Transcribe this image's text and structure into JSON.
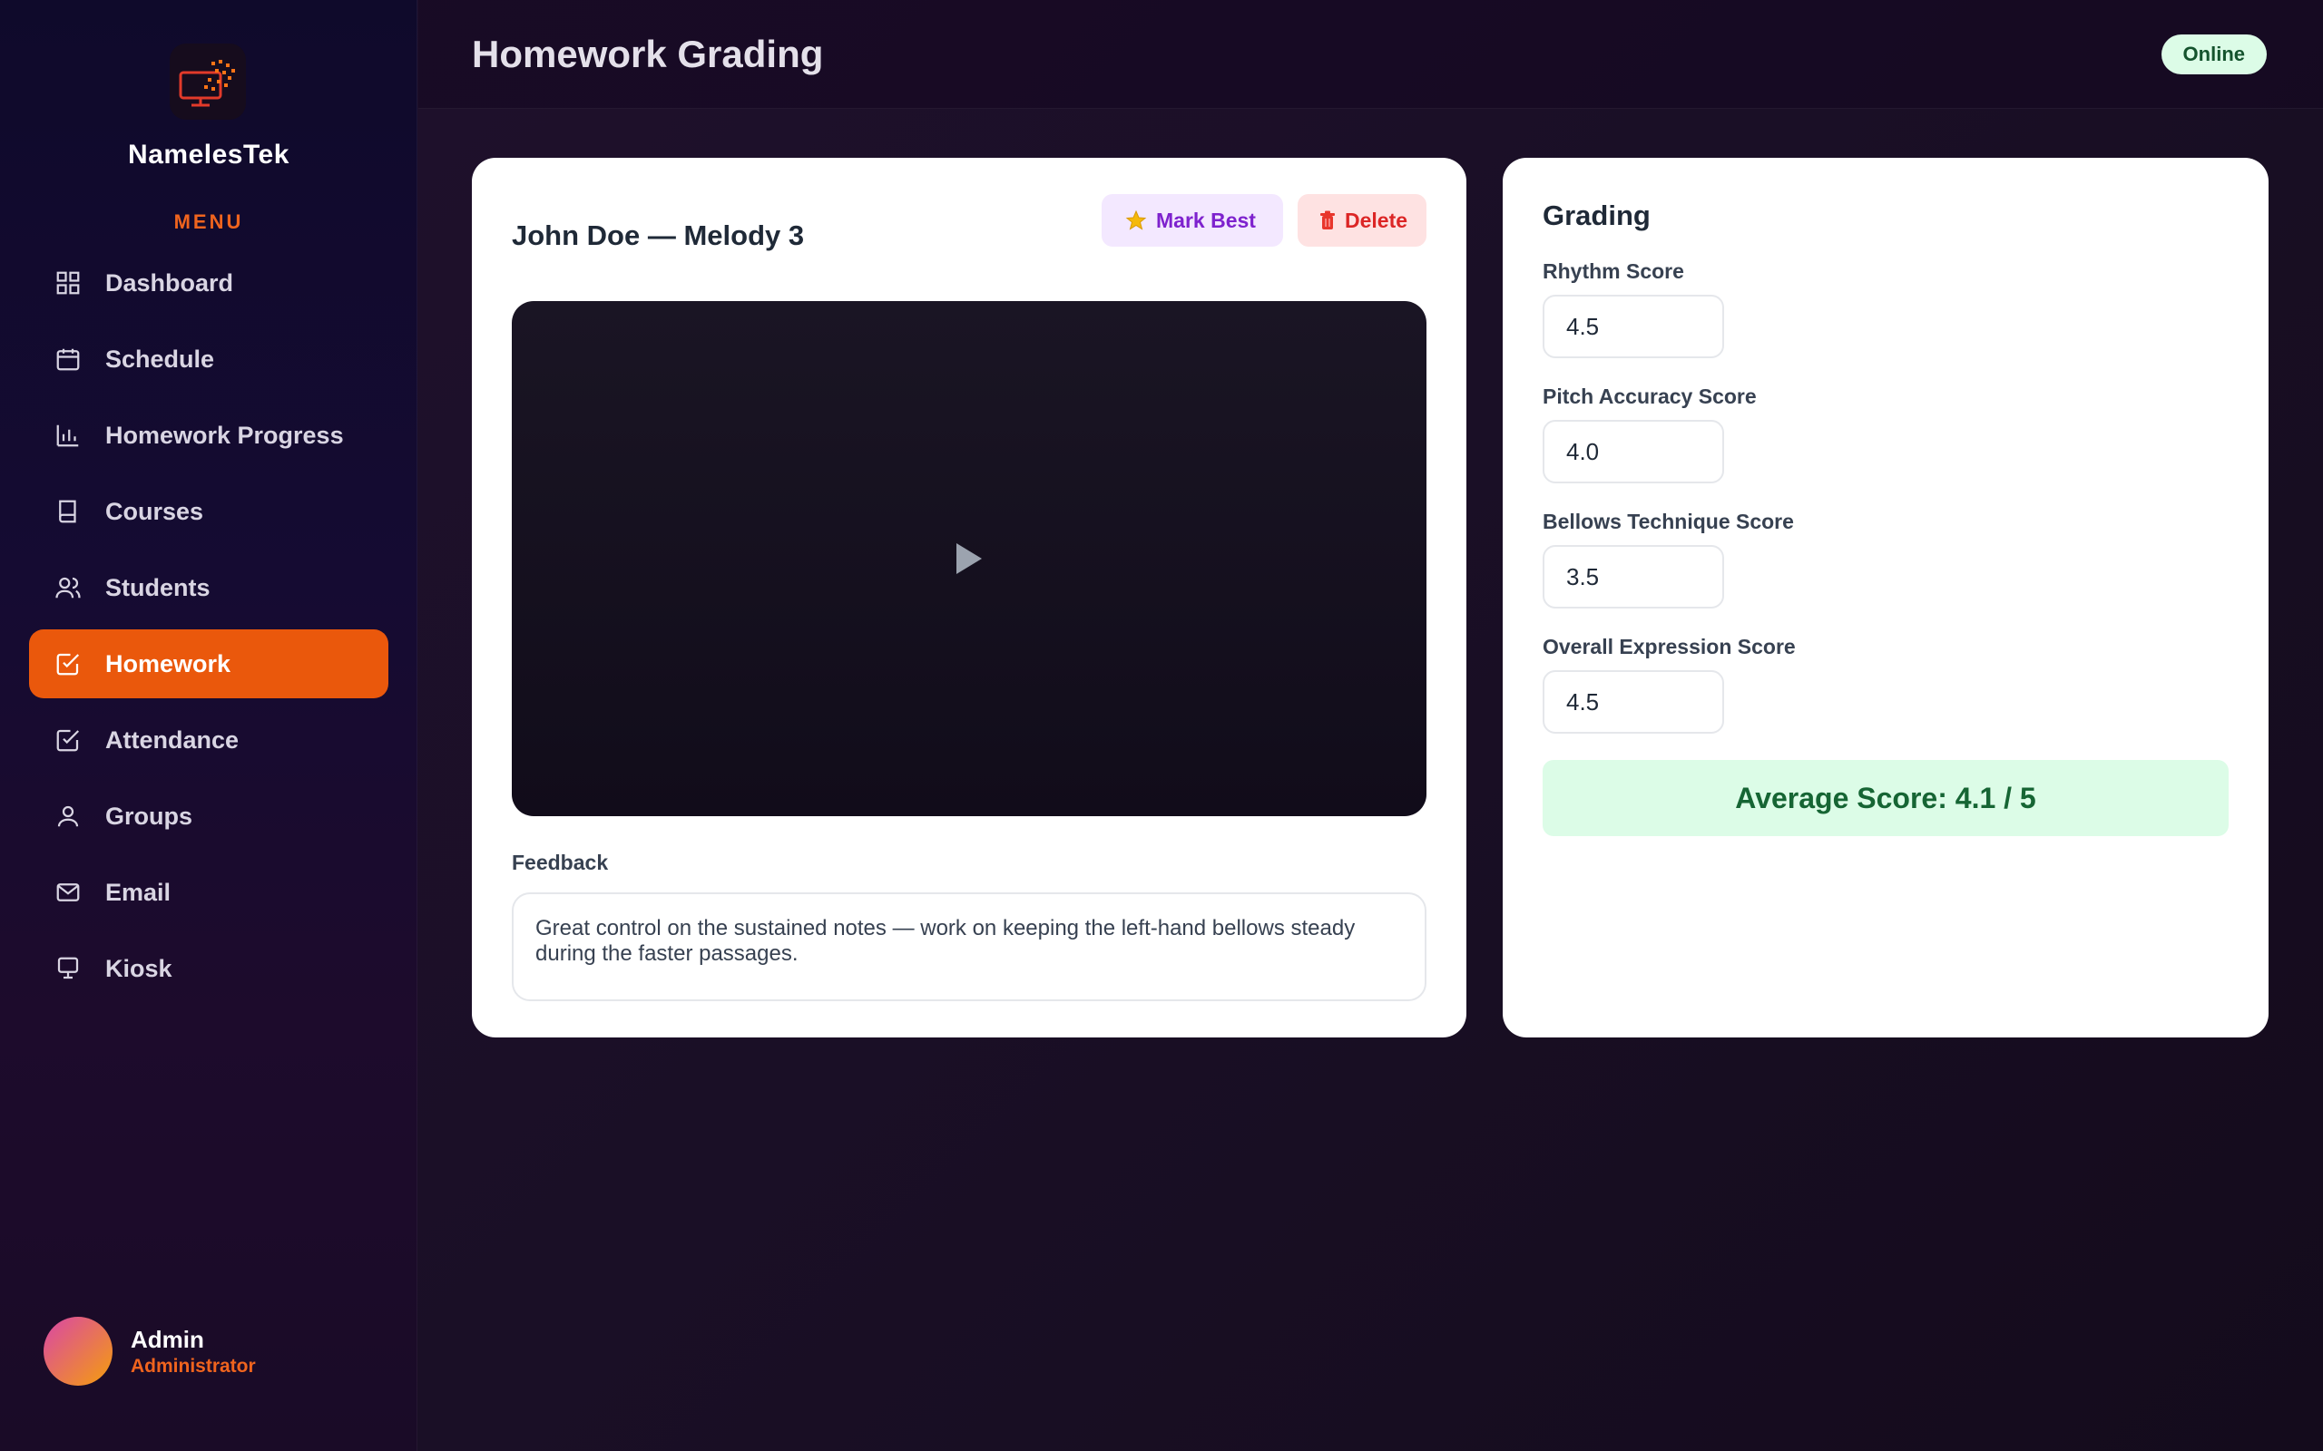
{
  "app": {
    "brand": "NamelesTek",
    "menu_label": "MENU"
  },
  "sidebar": {
    "items": [
      {
        "label": "Dashboard",
        "icon": "grid-icon"
      },
      {
        "label": "Schedule",
        "icon": "calendar-icon"
      },
      {
        "label": "Homework Progress",
        "icon": "bar-chart-icon"
      },
      {
        "label": "Courses",
        "icon": "book-icon"
      },
      {
        "label": "Students",
        "icon": "users-icon"
      },
      {
        "label": "Homework",
        "icon": "check-square-icon",
        "active": true
      },
      {
        "label": "Attendance",
        "icon": "check-square-icon"
      },
      {
        "label": "Groups",
        "icon": "user-icon"
      },
      {
        "label": "Email",
        "icon": "mail-icon"
      },
      {
        "label": "Kiosk",
        "icon": "monitor-icon"
      }
    ],
    "user": {
      "name": "Admin",
      "role": "Administrator"
    }
  },
  "header": {
    "title": "Homework Grading",
    "status": "Online"
  },
  "submission": {
    "title": "John Doe — Melody 3",
    "mark_best_label": "Mark Best",
    "delete_label": "Delete",
    "feedback_label": "Feedback",
    "feedback_text": "Great control on the sustained notes — work on keeping the left-hand bellows steady during the faster passages."
  },
  "grading": {
    "title": "Grading",
    "fields": [
      {
        "label": "Rhythm Score",
        "value": "4.5"
      },
      {
        "label": "Pitch Accuracy Score",
        "value": "4.0"
      },
      {
        "label": "Bellows Technique Score",
        "value": "3.5"
      },
      {
        "label": "Overall Expression Score",
        "value": "4.5"
      }
    ],
    "average_text": "Average Score: 4.1 / 5"
  },
  "colors": {
    "accent": "#ea580c",
    "status_bg": "#dcfce7",
    "status_text": "#14532d"
  }
}
